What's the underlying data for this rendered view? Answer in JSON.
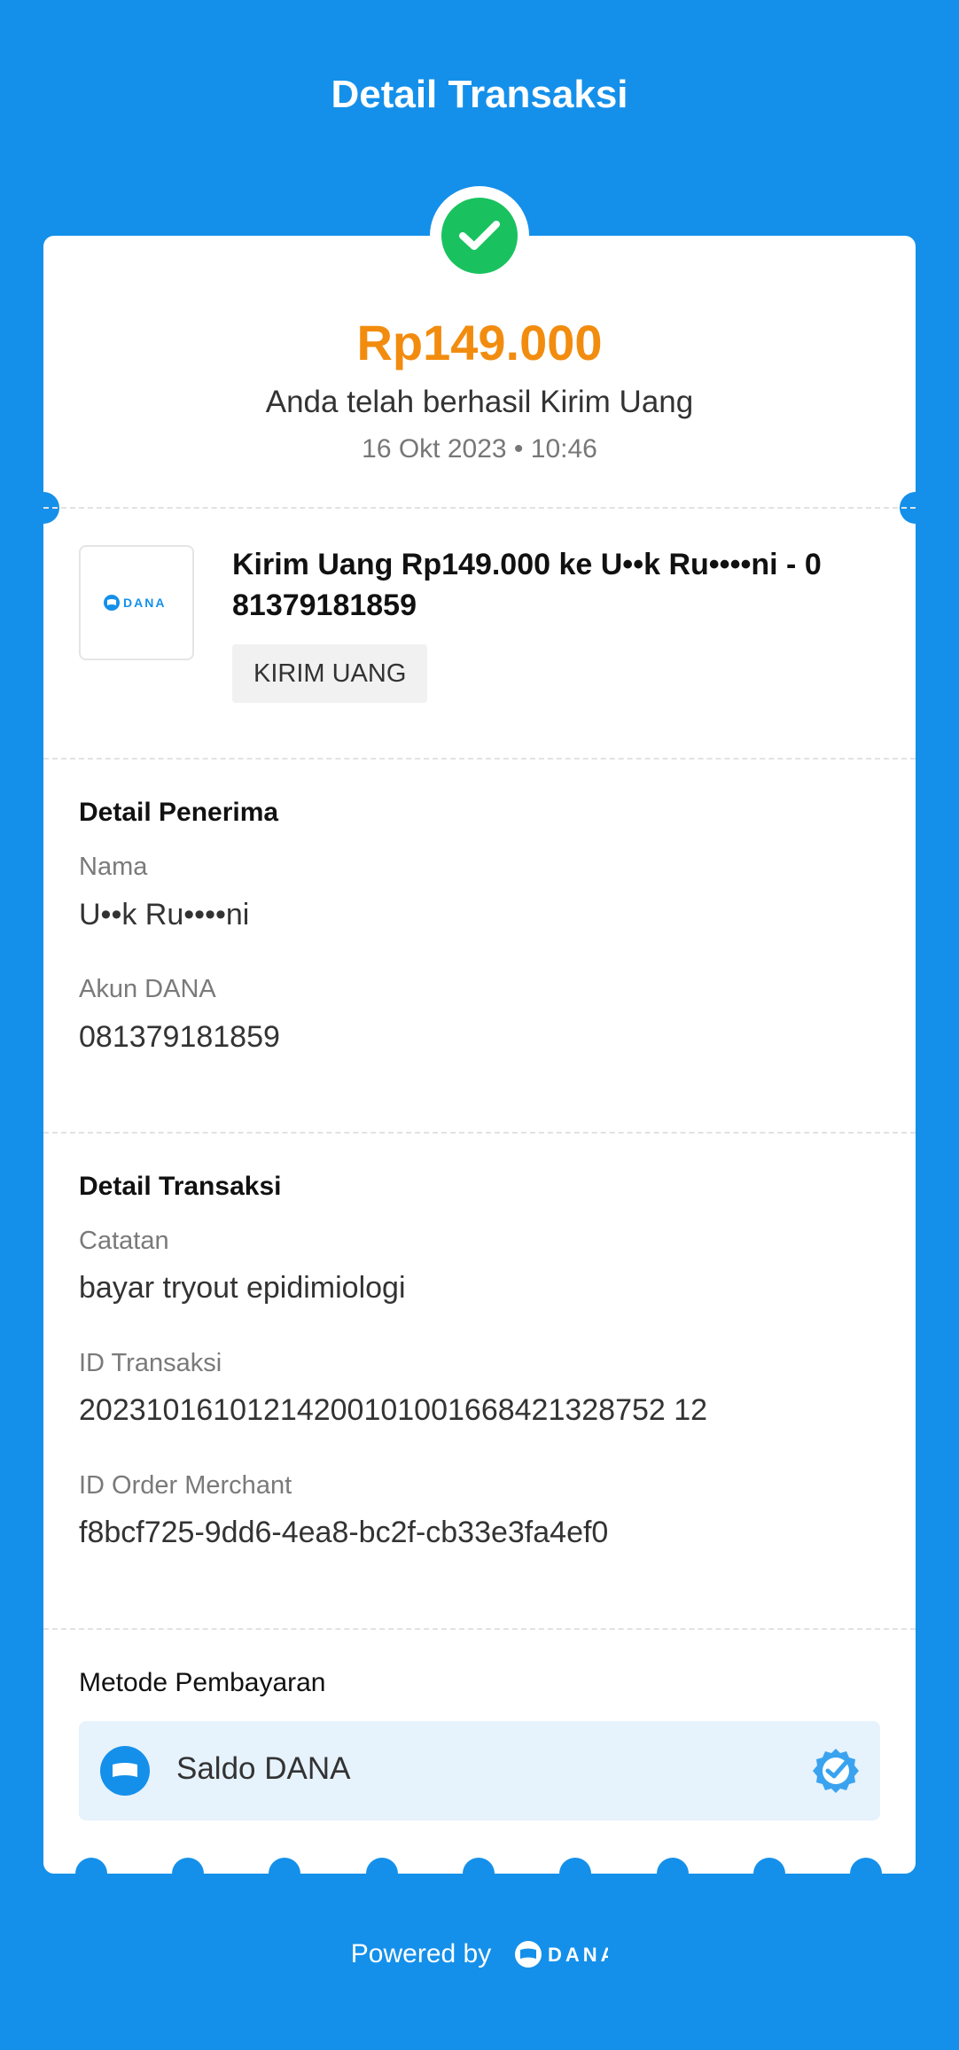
{
  "header": {
    "title": "Detail Transaksi"
  },
  "summary": {
    "amount": "Rp149.000",
    "message": "Anda telah berhasil Kirim Uang",
    "datetime": "16 Okt 2023 • 10:46",
    "status_icon": "check-circle-icon",
    "status_color": "#19C25F"
  },
  "transaction": {
    "logo_text": "DANA",
    "title": "Kirim Uang Rp149.000 ke U••k Ru••••ni - 0 81379181859",
    "tag": "KIRIM UANG"
  },
  "recipient": {
    "section_title": "Detail Penerima",
    "name_label": "Nama",
    "name_value": "U••k Ru••••ni",
    "account_label": "Akun DANA",
    "account_value": "081379181859"
  },
  "details": {
    "section_title": "Detail Transaksi",
    "note_label": "Catatan",
    "note_value": "bayar tryout epidimiologi",
    "tx_id_label": "ID Transaksi",
    "tx_id_value": "20231016101214200101001668421328752 12",
    "order_id_label": "ID Order Merchant",
    "order_id_value": "f8bcf725-9dd6-4ea8-bc2f-cb33e3fa4ef0"
  },
  "payment": {
    "title": "Metode Pembayaran",
    "method": "Saldo DANA",
    "selected_icon": "check-badge-icon"
  },
  "footer": {
    "powered_by": "Powered by",
    "brand": "DANA"
  },
  "colors": {
    "background": "#1490EA",
    "amount": "#F28C0F",
    "payment_box": "#E6F2FC"
  }
}
